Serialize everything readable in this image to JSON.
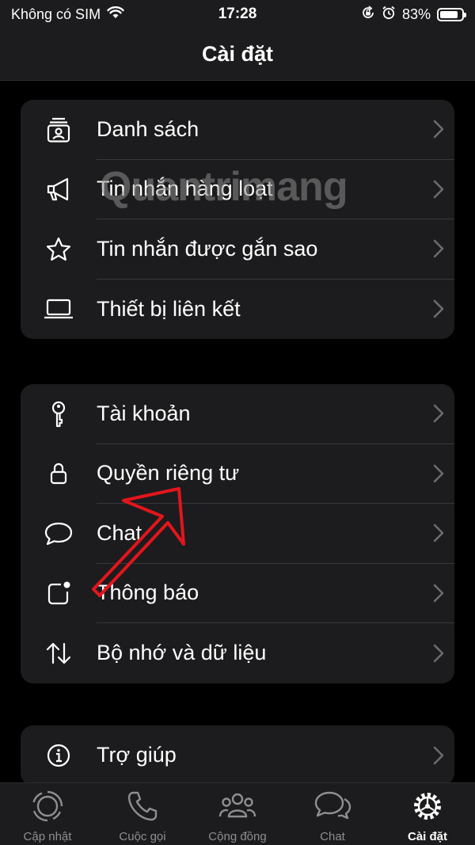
{
  "status_bar": {
    "carrier": "Không có SIM",
    "time": "17:28",
    "battery": "83%",
    "battery_level": 0.83
  },
  "nav": {
    "title": "Cài đặt"
  },
  "groups": [
    {
      "items": [
        {
          "label": "Danh sách",
          "icon": "list-icon"
        },
        {
          "label": "Tin nhắn hàng loạt",
          "icon": "megaphone-icon"
        },
        {
          "label": "Tin nhắn được gắn sao",
          "icon": "star-icon"
        },
        {
          "label": "Thiết bị liên kết",
          "icon": "laptop-icon"
        }
      ]
    },
    {
      "items": [
        {
          "label": "Tài khoản",
          "icon": "key-icon"
        },
        {
          "label": "Quyền riêng tư",
          "icon": "lock-icon"
        },
        {
          "label": "Chat",
          "icon": "chat-bubble-icon"
        },
        {
          "label": "Thông báo",
          "icon": "notification-icon"
        },
        {
          "label": "Bộ nhớ và dữ liệu",
          "icon": "sort-arrows-icon"
        }
      ]
    },
    {
      "items": [
        {
          "label": "Trợ giúp",
          "icon": "info-icon"
        }
      ]
    }
  ],
  "tab_bar": {
    "tabs": [
      {
        "label": "Cập nhật",
        "icon": "status-icon",
        "active": false
      },
      {
        "label": "Cuộc gọi",
        "icon": "phone-icon",
        "active": false
      },
      {
        "label": "Cộng đồng",
        "icon": "community-icon",
        "active": false
      },
      {
        "label": "Chat",
        "icon": "chats-icon",
        "active": false
      },
      {
        "label": "Cài đặt",
        "icon": "settings-gear-icon",
        "active": true
      }
    ]
  },
  "watermark": "Quantrimang",
  "colors": {
    "background": "#000000",
    "surface": "#1c1c1e",
    "separator": "#38383a",
    "chevron": "#6b6b70",
    "annotation_arrow": "#e3151c"
  }
}
